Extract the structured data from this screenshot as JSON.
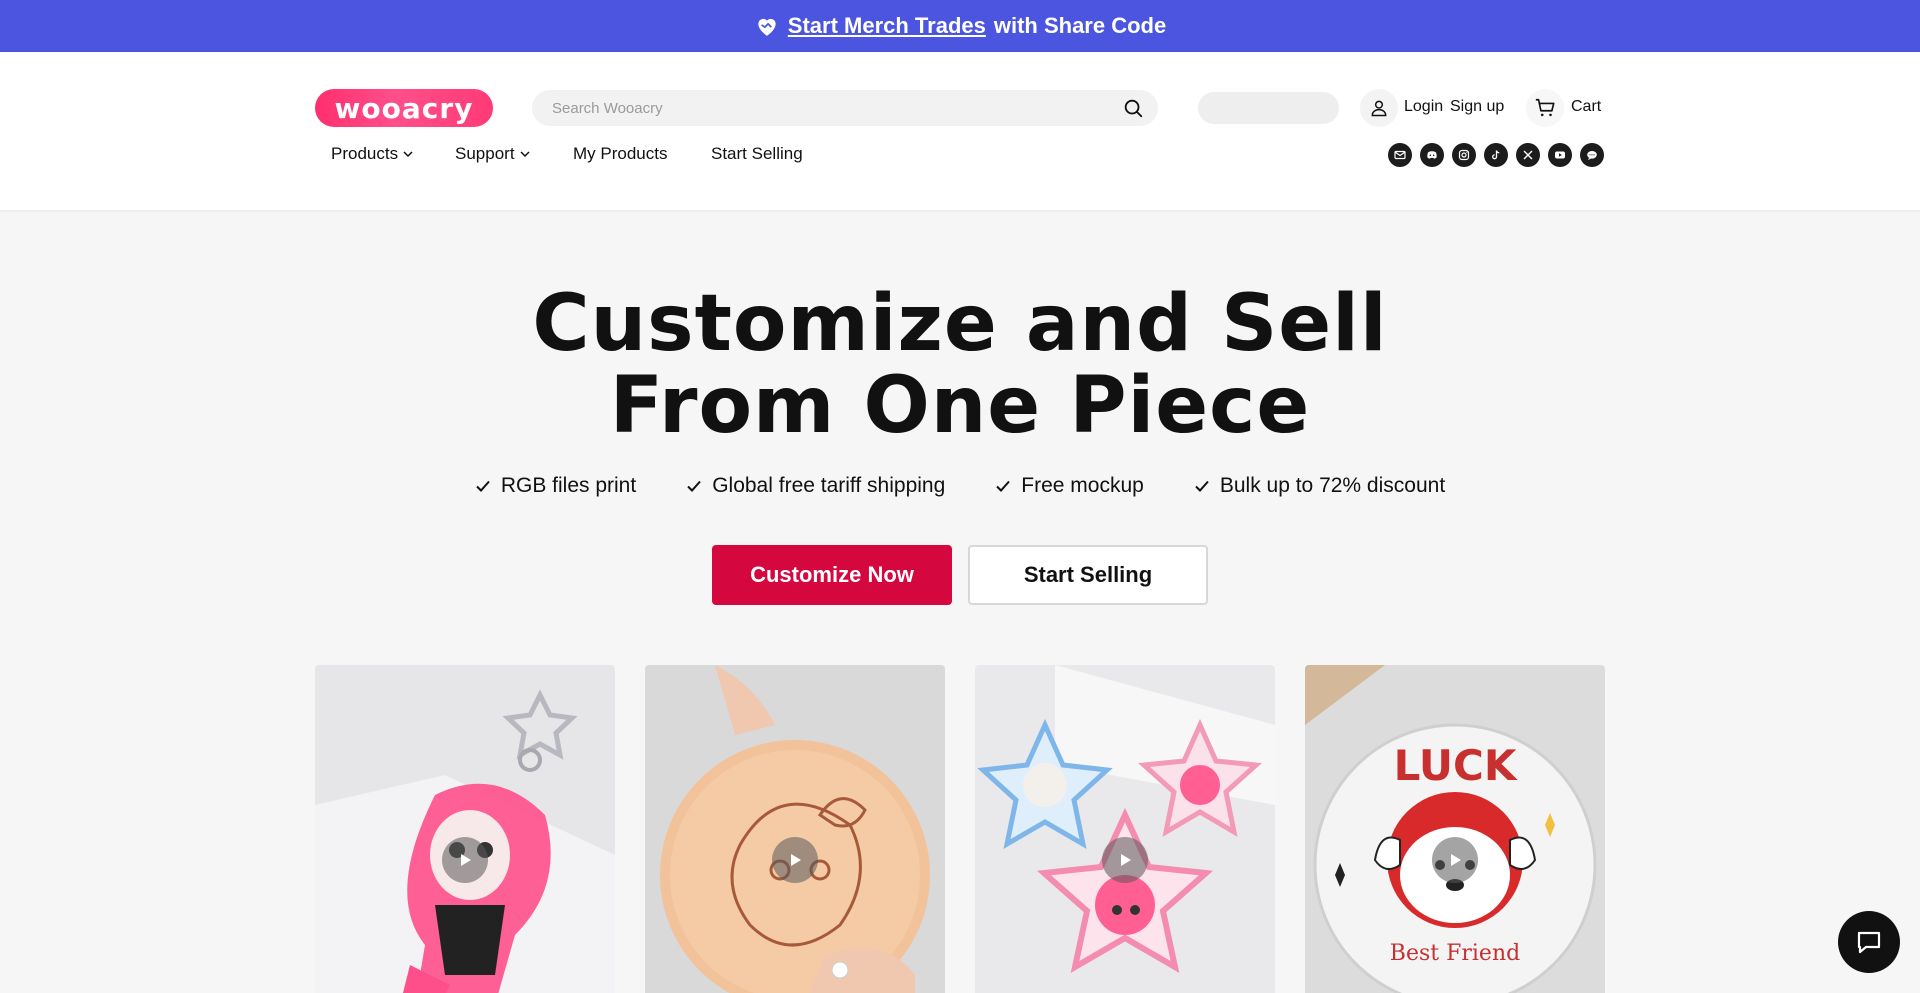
{
  "announcement": {
    "link_text": "Start Merch Trades",
    "rest_text": "with Share Code",
    "background": "#4b55e0",
    "icon": "heart-handshake-icon"
  },
  "header": {
    "logo_text": "wooacry",
    "search": {
      "placeholder": "Search Wooacry",
      "value": ""
    },
    "login_label": "Login",
    "signup_label": "Sign up",
    "cart_label": "Cart"
  },
  "nav": {
    "products": "Products",
    "support": "Support",
    "my_products": "My Products",
    "start_selling": "Start Selling"
  },
  "socials": [
    "mail-icon",
    "discord-icon",
    "instagram-icon",
    "tiktok-icon",
    "x-icon",
    "youtube-icon",
    "chat-bubble-icon"
  ],
  "hero": {
    "title_line1": "Customize and Sell",
    "title_line2": "From One Piece",
    "features": [
      "RGB files print",
      "Global free tariff shipping",
      "Free mockup",
      "Bulk up to 72% discount"
    ],
    "primary_button": "Customize Now",
    "secondary_button": "Start Selling",
    "accent_color": "#d4073f"
  },
  "products": [
    {
      "type": "acrylic-keychain-video"
    },
    {
      "type": "printed-cookie-video"
    },
    {
      "type": "star-stickers-video"
    },
    {
      "type": "button-badge-video"
    }
  ]
}
